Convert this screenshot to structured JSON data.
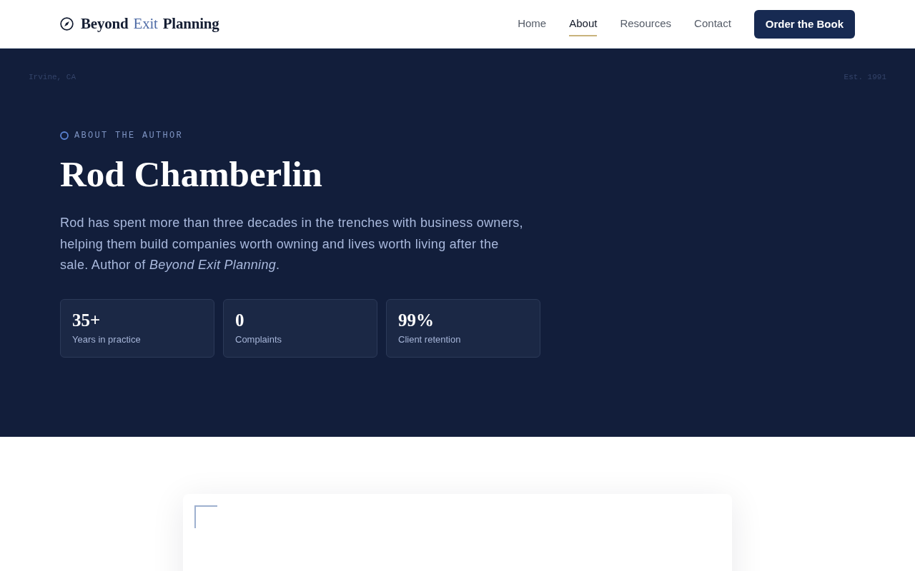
{
  "header": {
    "logo": {
      "lead": "Beyond",
      "highlight": "Exit",
      "tail": "Planning"
    },
    "nav": [
      {
        "label": "Home",
        "selected": false
      },
      {
        "label": "About",
        "selected": true
      },
      {
        "label": "Resources",
        "selected": false
      },
      {
        "label": "Contact",
        "selected": false
      }
    ],
    "cta": "Order the Book"
  },
  "hero": {
    "location": "Irvine, CA",
    "established": "Est. 1991",
    "eyebrow": "ABOUT THE AUTHOR",
    "title": "Rod Chamberlin",
    "intro": "Rod has spent more than three decades in the trenches with business owners, helping them build companies worth owning and lives worth living after the sale. Author of *Beyond Exit Planning*.",
    "stats": [
      {
        "value": "35+",
        "label": "Years in practice"
      },
      {
        "value": "0",
        "label": "Complaints"
      },
      {
        "value": "99%",
        "label": "Client retention"
      }
    ]
  }
}
